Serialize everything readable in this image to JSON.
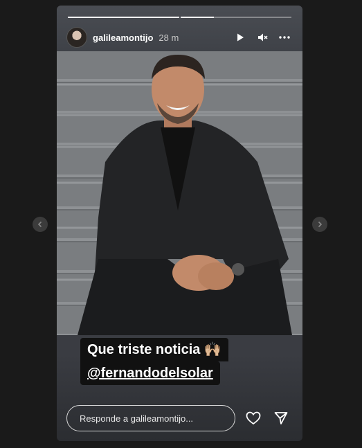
{
  "story": {
    "username": "galileamontijo",
    "time_ago": "28 m",
    "progress": [
      1.0,
      0.3
    ]
  },
  "caption": {
    "line1": "Que triste noticia 🙌🏼",
    "line2": "@fernandodelsolar"
  },
  "reply": {
    "placeholder": "Responde a galileamontijo..."
  },
  "icons": {
    "play": "play-icon",
    "mute": "volume-muted-icon",
    "more": "more-options-icon",
    "like": "heart-icon",
    "share": "send-icon",
    "prev": "chevron-left-icon",
    "next": "chevron-right-icon"
  }
}
